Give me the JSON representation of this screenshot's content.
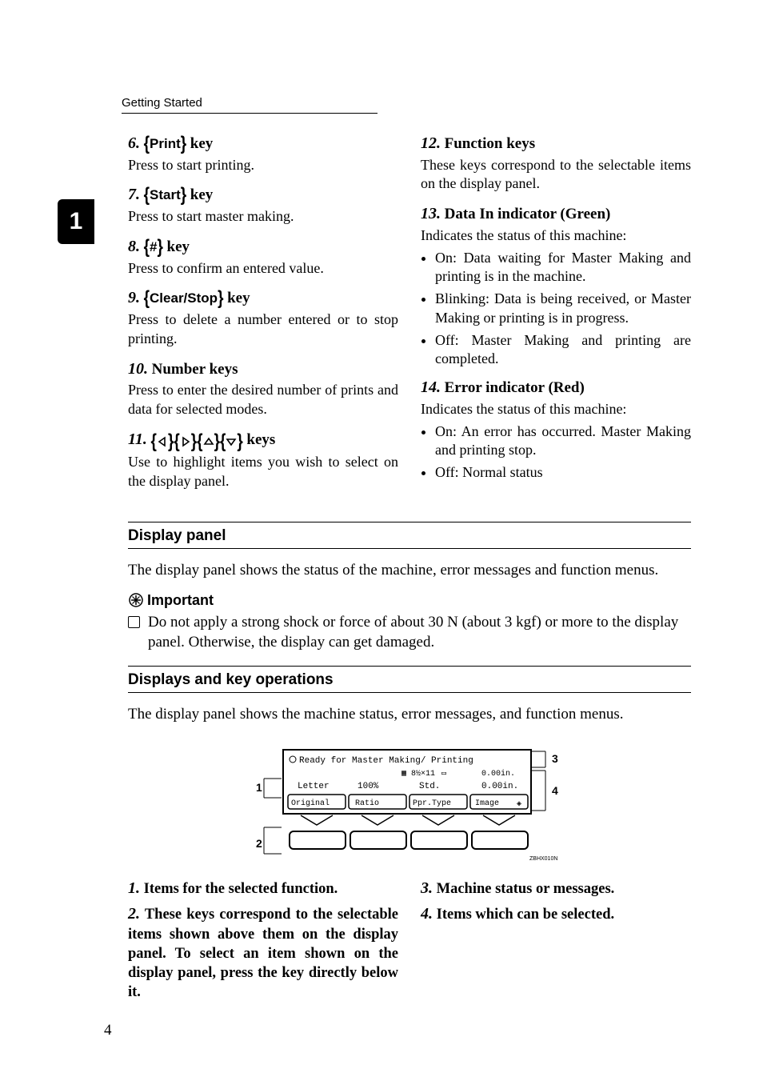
{
  "runningHead": "Getting Started",
  "sideTab": "1",
  "leftItems": [
    {
      "num": "6.",
      "btn": "Print",
      "word": "key",
      "body": "Press to start printing."
    },
    {
      "num": "7.",
      "btn": "Start",
      "word": "key",
      "body": "Press to start master making."
    },
    {
      "num": "8.",
      "btn": "#",
      "word": "key",
      "body": "Press to confirm an entered value."
    },
    {
      "num": "9.",
      "btn": "Clear/Stop",
      "word": "key",
      "body": "Press to delete a number entered or to stop printing."
    },
    {
      "num": "10.",
      "plain": "Number keys",
      "body": "Press to enter the desired number of prints and data for selected modes."
    },
    {
      "num": "11.",
      "arrows": true,
      "word": "keys",
      "body": "Use to highlight items you wish to select on the display panel."
    }
  ],
  "rightItems": [
    {
      "num": "12.",
      "plain": "Function keys",
      "body": "These keys correspond to the selectable items on the display panel."
    },
    {
      "num": "13.",
      "plain": "Data In indicator (Green)",
      "body": "Indicates the status of this machine:",
      "bullets": [
        "On: Data waiting for Master Making and printing is in the machine.",
        "Blinking: Data is being received, or Master Making or printing is in progress.",
        "Off: Master Making and printing are completed."
      ]
    },
    {
      "num": "14.",
      "plain": "Error indicator (Red)",
      "body": "Indicates the status of this machine:",
      "bullets": [
        "On: An error has occurred. Master Making and printing stop.",
        "Off: Normal status"
      ]
    }
  ],
  "displayPanel": {
    "title": "Display panel",
    "intro": "The display panel shows the status of the machine, error messages and function menus.",
    "importantLabel": "Important",
    "importantText": "Do not apply a strong shock or force of about 30 N (about 3 kgf) or more to the display panel. Otherwise, the display can get damaged."
  },
  "displaysKeys": {
    "title": "Displays and key operations",
    "intro": "The display panel shows the machine status, error messages, and function menus."
  },
  "chart_data": {
    "type": "table",
    "title": "Display panel layout diagram",
    "callouts": [
      {
        "n": 1,
        "label": "Items for the selected function."
      },
      {
        "n": 2,
        "label": "These keys correspond to the selectable items shown above them on the display panel. To select an item shown on the display panel, press the key directly below it."
      },
      {
        "n": 3,
        "label": "Machine status or messages."
      },
      {
        "n": 4,
        "label": "Items which can be selected."
      }
    ],
    "lcd": {
      "statusLine": "Ready for Master Making/ Printing",
      "iconsLine": {
        "paperSize": "8½×11",
        "rightValue": "0.00in."
      },
      "row": [
        "Letter",
        "100%",
        "Std.",
        "0.00in."
      ],
      "tabs": [
        "Original",
        "Ratio",
        "Ppr.Type",
        "Image"
      ]
    },
    "figureCode": "ZBHX010N"
  },
  "bottomLeft": [
    {
      "num": "1.",
      "text": "Items for the selected function."
    },
    {
      "num": "2.",
      "text": "These keys correspond to the selectable items shown above them on the display panel. To select an item shown on the display panel, press the key directly below it."
    }
  ],
  "bottomRight": [
    {
      "num": "3.",
      "text": "Machine status or messages."
    },
    {
      "num": "4.",
      "text": "Items which can be selected."
    }
  ],
  "pageNumber": "4"
}
